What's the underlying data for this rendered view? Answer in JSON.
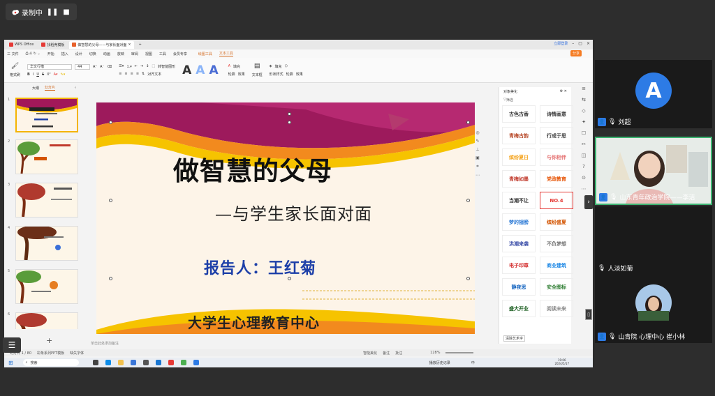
{
  "recording": {
    "label": "录制中"
  },
  "tabs": [
    {
      "label": "WPS Office"
    },
    {
      "label": "找稻壳模板"
    },
    {
      "label": "做智慧的父母——与家长面对面"
    }
  ],
  "title_right": {
    "login": "立即登录"
  },
  "menus": [
    "三 文件",
    "开始",
    "插入",
    "设计",
    "切换",
    "动画",
    "放映",
    "审阅",
    "视图",
    "工具",
    "会员专享",
    "绘图工具",
    "文本工具"
  ],
  "share_label": "分享",
  "toolbar": {
    "format_brush": "格式刷",
    "font_name": "华文行楷",
    "font_size": "44",
    "text_box": "文本框",
    "convert_shape": "转智能图形",
    "align_text": "对齐文本",
    "fill": "填充",
    "outline": "轮廓",
    "effect": "效果",
    "shape_style": "形状样式"
  },
  "sidebar": {
    "outline": "大纲",
    "slides": "幻灯片"
  },
  "thumbs": [
    {
      "num": "1"
    },
    {
      "num": "2"
    },
    {
      "num": "3"
    },
    {
      "num": "4"
    },
    {
      "num": "5"
    },
    {
      "num": "6"
    }
  ],
  "notes_placeholder": "单击此处添加备注",
  "slide": {
    "title": "做智慧的父母",
    "subtitle": "—与学生家长面对面",
    "reporter": "报告人：王红菊",
    "org": "大学生心理教育中心"
  },
  "panel": {
    "title": "对象美化",
    "filter": "筛选",
    "styles": [
      "古色古香",
      "诗情画意",
      "青梅古韵",
      "行成于思",
      "缤纷夏日",
      "与你相伴",
      "青梅如墨",
      "党政教育",
      "当潮不让",
      "NO.4",
      "梦的翅膀",
      "缤纷盛夏",
      "洪潮来袭",
      "不负梦想",
      "电子印章",
      "商业建筑",
      "静夜思",
      "安全图标",
      "盛大开业",
      "阅读未来"
    ],
    "footer": "清除艺术字"
  },
  "status": {
    "slide_count": "幻灯片 1 / 80",
    "template": "彩条系列PPT模板",
    "font": "缺失字体",
    "beautify": "智能美化",
    "notes": "备注",
    "comment": "批注",
    "zoom": "128%"
  },
  "taskbar": {
    "search": "搜索",
    "history": "播放历史记录",
    "ime": "中",
    "time": "19:06",
    "date": "2024/5/17"
  },
  "participants": [
    {
      "name": "刘超",
      "avatar_letter": "A"
    },
    {
      "name": "山东青年政治学院——李洁"
    },
    {
      "name": "人淡如菊"
    },
    {
      "name": "山青院 心理中心 崔小林"
    }
  ],
  "colors": {
    "accent": "#f57c23",
    "blue_title": "#1d3fa8",
    "active_border": "#3cb371"
  }
}
